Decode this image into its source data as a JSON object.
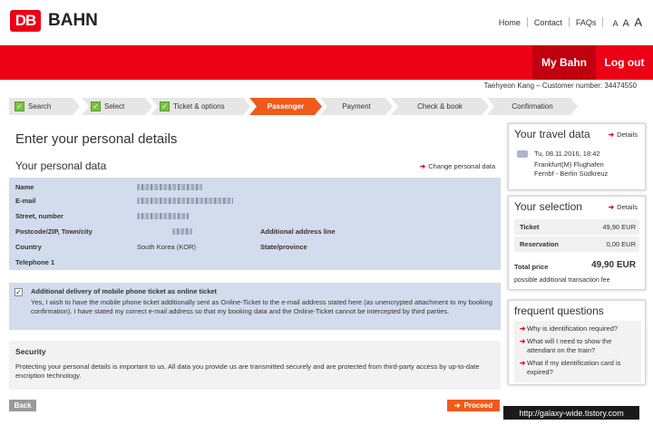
{
  "header": {
    "logo_mark": "DB",
    "logo_text": "BAHN",
    "links": {
      "home": "Home",
      "contact": "Contact",
      "faqs": "FAQs"
    },
    "font_sizes": [
      "A",
      "A",
      "A"
    ],
    "my_bahn": "My Bahn",
    "logout": "Log out",
    "customer": "Taehyeon Kang – Customer number: 34474550"
  },
  "steps": [
    {
      "label": "Search",
      "state": "done"
    },
    {
      "label": "Select",
      "state": "done"
    },
    {
      "label": "Ticket & options",
      "state": "done"
    },
    {
      "label": "Passenger",
      "state": "active"
    },
    {
      "label": "Payment",
      "state": "pending"
    },
    {
      "label": "Check & book",
      "state": "pending"
    },
    {
      "label": "Confirmation",
      "state": "pending"
    }
  ],
  "main": {
    "title": "Enter your personal details",
    "subtitle": "Your personal data",
    "change_link": "Change personal data",
    "fields": {
      "name": "Name",
      "email": "E-mail",
      "street": "Street, number",
      "postcode": "Postcode/ZIP, Town/city",
      "additional": "Additional address line",
      "country": "Country",
      "country_value": "South Korea (KOR)",
      "state": "State/province",
      "telephone": "Telephone 1"
    },
    "delivery": {
      "checked": true,
      "title": "Additional delivery of mobile phone ticket as online ticket",
      "text": "Yes, I wish to have the mobile phone ticket additionally sent as Online-Ticket to the e-mail address stated here (as unencrypted attachment to my booking confirmation). I have stated my correct e-mail address so that my booking data and the Online-Ticket cannot be intercepted by third parties."
    },
    "security": {
      "title": "Security",
      "text": "Protecting your personal details is important to us. All data you provide us are transmitted securely and are protected from third-party access by up-to-date encription technology."
    },
    "back": "Back",
    "proceed": "Proceed"
  },
  "sidebar": {
    "travel": {
      "title": "Your travel data",
      "details": "Details",
      "date": "Tu, 08.11.2016, 18:42",
      "route_line1": "Frankfurt(M) Flughafen",
      "route_line2": "Fernbf - Berlin Südkreuz"
    },
    "selection": {
      "title": "Your selection",
      "details": "Details",
      "ticket_label": "Ticket",
      "ticket_value": "49,90 EUR",
      "reservation_label": "Reservation",
      "reservation_value": "0,00 EUR",
      "total_label": "Total price",
      "total_value": "49,90 EUR",
      "note": "possible additional transaction fee"
    },
    "faq": {
      "title": "frequent questions",
      "items": [
        "Why is identification required?",
        "What will I need to show the attendant on the train?",
        "What if my identification card is expired?"
      ]
    }
  },
  "watermark": "http://galaxy-wide.tistory.com",
  "colors": {
    "brand_red": "#ec0016",
    "active_step": "#f05a1a",
    "data_bg": "#d2dcec"
  }
}
